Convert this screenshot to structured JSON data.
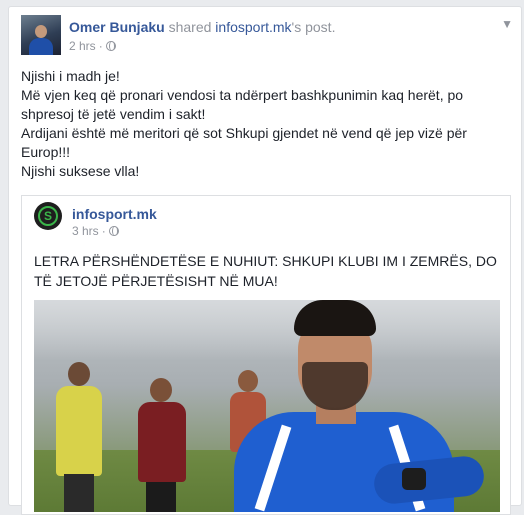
{
  "post": {
    "author": "Omer Bunjaku",
    "shared_word": "shared",
    "shared_page": "infosport.mk",
    "shared_suffix": "'s post.",
    "time": "2 hrs",
    "privacy_separator": "·",
    "privacy_icon": "globe-icon",
    "options_icon": "chevron-down-icon",
    "message": [
      "Njishi i madh je!",
      "Më vjen keq që pronari vendosi ta ndërpert bashkpunimin kaq herët, po shpresoj të jetë vendim i sakt!",
      "Ardijani është më meritori që sot Shkupi gjendet në vend që jep vizë për Europ!!!",
      "Njishi suksese vlla!"
    ]
  },
  "shared": {
    "page_name": "infosport.mk",
    "logo_letter": "S",
    "time": "3 hrs",
    "privacy_separator": "·",
    "privacy_icon": "globe-icon",
    "text": "LETRA PËRSHËNDETËSE E NUHIUT: SHKUPI KLUBI IM I ZEMRËS, DO TË JETOJË PËRJETËSISHT NË MUA!"
  },
  "colors": {
    "link": "#365899",
    "text": "#1d2129",
    "meta": "#90949c",
    "page_bg": "#e9ebee",
    "logo_green": "#3bb54a"
  }
}
